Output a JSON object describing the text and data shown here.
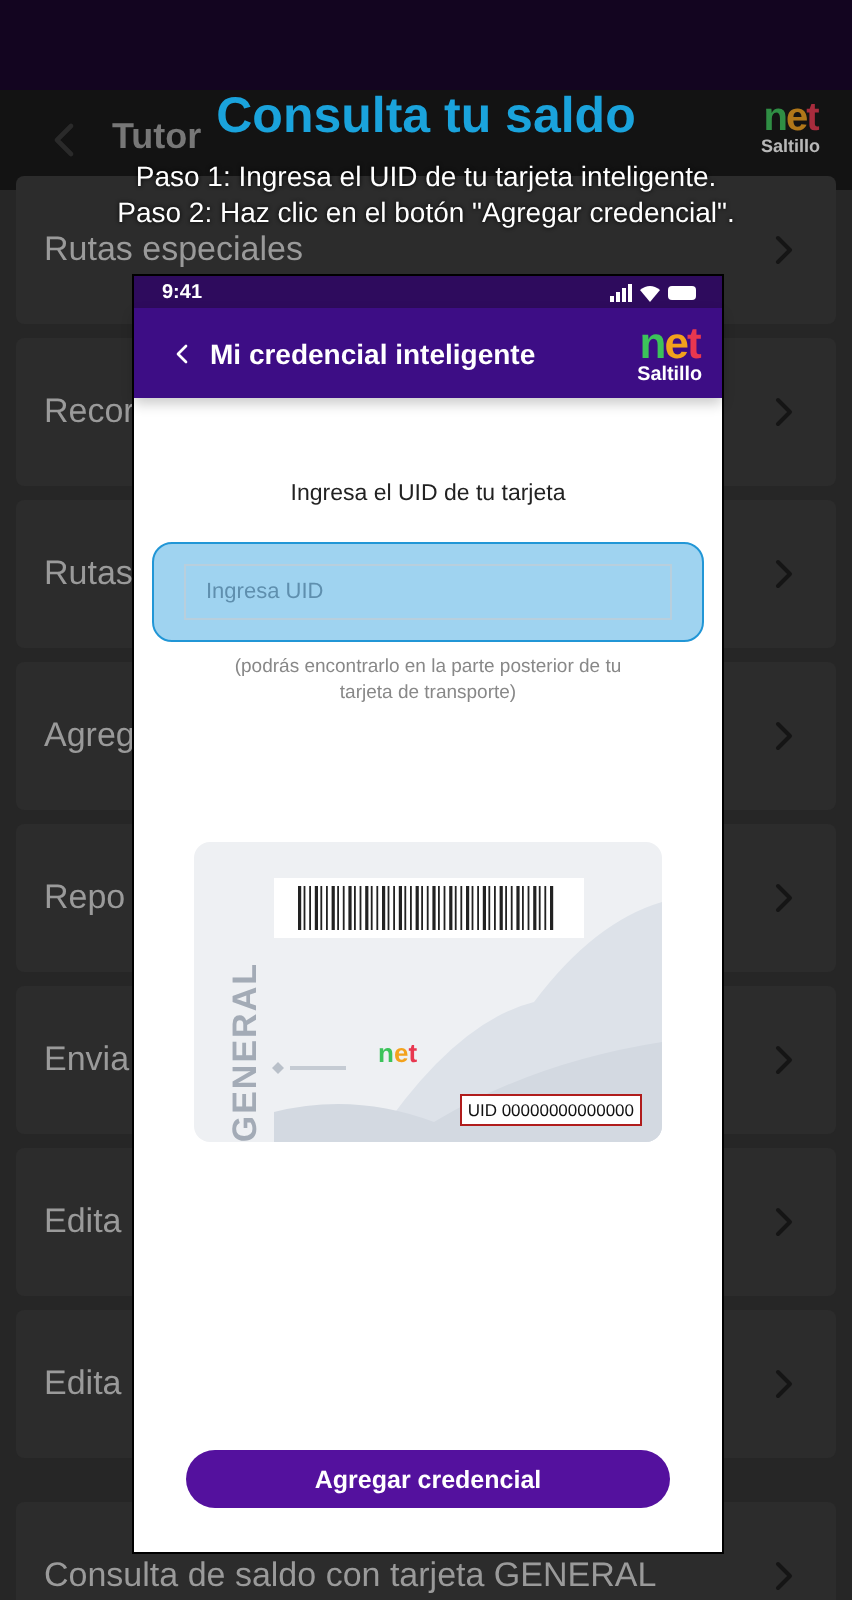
{
  "top_bar": {
    "title": "Tutor",
    "logo": {
      "word": "net",
      "city": "Saltillo"
    }
  },
  "rows": [
    {
      "label": "Rutas especiales"
    },
    {
      "label": "Recor"
    },
    {
      "label": "Rutas"
    },
    {
      "label": "Agreg"
    },
    {
      "label": "Repo"
    },
    {
      "label": "Envia"
    },
    {
      "label": "Edita"
    },
    {
      "label": "Edita"
    },
    {
      "label": "Consulta de saldo con tarjeta GENERAL"
    }
  ],
  "tutorial": {
    "title": "Consulta tu saldo",
    "steps": [
      "Paso 1: Ingresa el UID de tu tarjeta inteligente.",
      "Paso 2: Haz clic en el botón \"Agregar credencial\"."
    ]
  },
  "phone": {
    "time": "9:41",
    "nav_title": "Mi credencial inteligente",
    "logo": {
      "word": "net",
      "city": "Saltillo"
    },
    "prompt": "Ingresa el UID de tu tarjeta",
    "uid_field": {
      "placeholder": "Ingresa UID",
      "highlighted": true
    },
    "hint": "(podrás encontrarlo en la parte posterior de tu tarjeta de transporte)",
    "card": {
      "type_label": "GENERAL",
      "logo_word": "net",
      "uid": "UID 00000000000000"
    },
    "button": "Agregar credencial"
  }
}
